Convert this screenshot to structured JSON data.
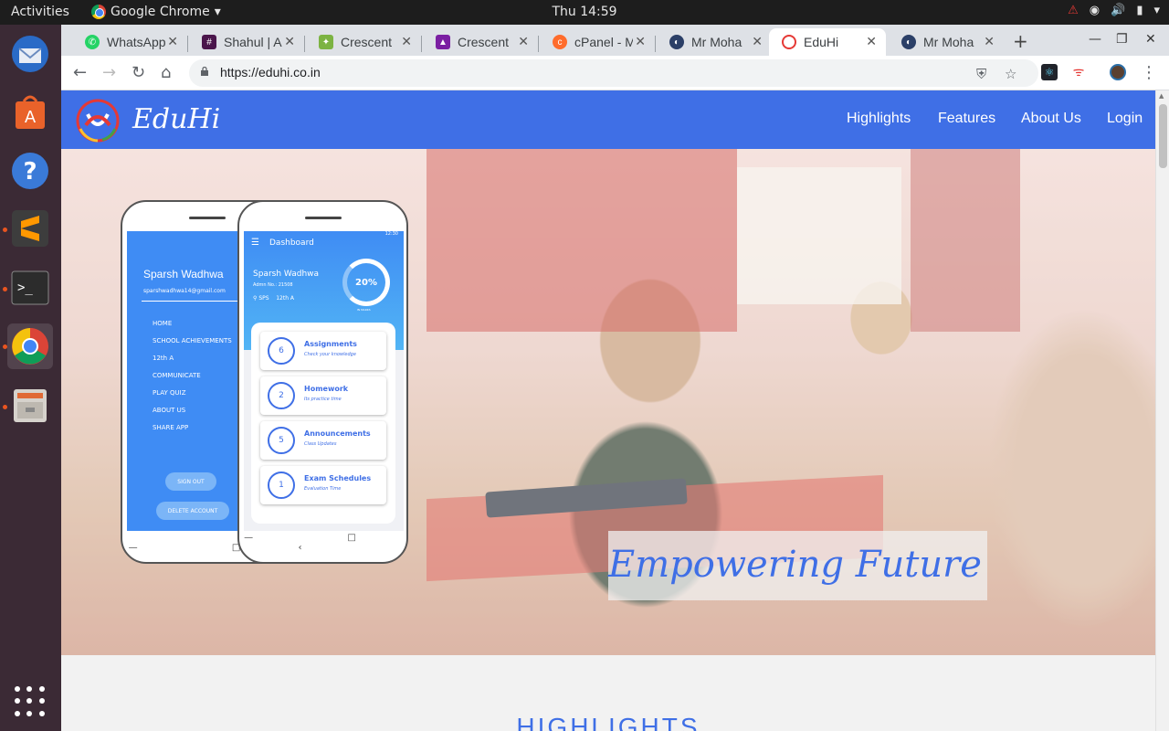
{
  "topbar": {
    "activities": "Activities",
    "app_name": "Google Chrome",
    "clock": "Thu 14:59"
  },
  "dock": {
    "items": [
      "thunderbird-icon",
      "software-center-icon",
      "help-icon",
      "sublime-text-icon",
      "terminal-icon",
      "chrome-icon",
      "files-icon"
    ],
    "apps_grid": "show-applications-icon"
  },
  "tabs": [
    {
      "title": "WhatsApp",
      "fav_color": "#25d366",
      "icon": "whatsapp-icon"
    },
    {
      "title": "Shahul | A",
      "fav_color": "#4a154b",
      "icon": "slack-icon"
    },
    {
      "title": "Crescent",
      "fav_color": "#7cb342",
      "icon": "crescent-icon"
    },
    {
      "title": "Crescent",
      "fav_color": "#7b1fa2",
      "icon": "graduation-cap-icon"
    },
    {
      "title": "cPanel - M",
      "fav_color": "#ff6c2c",
      "icon": "cpanel-icon"
    },
    {
      "title": "Mr Moha",
      "fav_color": "#2b3f67",
      "icon": "globe-icon"
    },
    {
      "title": "EduHi",
      "fav_color": "#e53935",
      "icon": "eduhi-icon",
      "active": true
    },
    {
      "title": "Mr Moha",
      "fav_color": "#2b3f67",
      "icon": "globe-icon"
    }
  ],
  "toolbar": {
    "url": "https://eduhi.co.in"
  },
  "site": {
    "brand": "EduHi",
    "nav": [
      "Highlights",
      "Features",
      "About Us",
      "Login"
    ],
    "tagline": "Empowering Future",
    "section_heading": "HIGHLIGHTS"
  },
  "phone_left": {
    "name": "Sparsh Wadhwa",
    "email": "sparshwadhwa14@gmail.com",
    "menu": [
      "HOME",
      "SCHOOL ACHIEVEMENTS",
      "12th A",
      "COMMUNICATE",
      "PLAY QUIZ",
      "ABOUT US",
      "SHARE APP"
    ],
    "sign_out": "SIGN OUT",
    "delete": "DELETE ACCOUNT"
  },
  "phone_right": {
    "title": "Dashboard",
    "time": "12:30",
    "name": "Sparsh Wadhwa",
    "admission": "Admn No.: 21508",
    "school": "SPS",
    "class": "12th A",
    "progress": "20%",
    "progress_caption": "IN MARKS",
    "cards": [
      {
        "num": "6",
        "title": "Assignments",
        "sub": "Check your knowledge"
      },
      {
        "num": "2",
        "title": "Homework",
        "sub": "Its practice time"
      },
      {
        "num": "5",
        "title": "Announcements",
        "sub": "Class Updates"
      },
      {
        "num": "1",
        "title": "Exam Schedules",
        "sub": "Evaluation Time"
      }
    ]
  },
  "colors": {
    "brand_blue": "#3f6fe6"
  }
}
